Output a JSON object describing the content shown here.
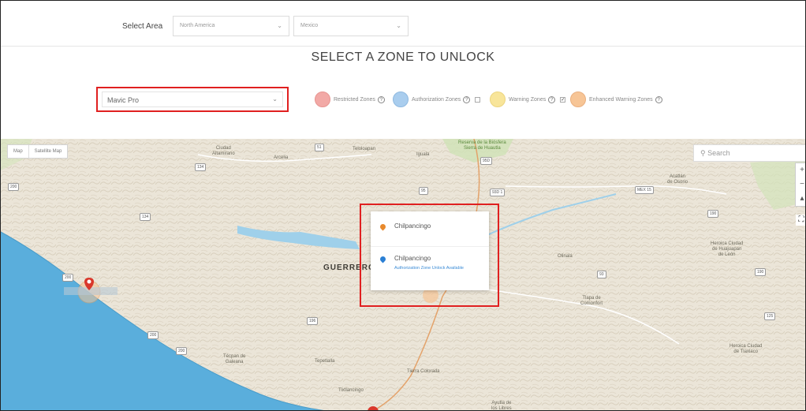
{
  "area_bar": {
    "label": "Select Area",
    "continent": "North America",
    "country": "Mexico"
  },
  "title": "SELECT A ZONE TO UNLOCK",
  "drone": {
    "selected": "Mavic Pro"
  },
  "legend": [
    {
      "label": "Restricted Zones",
      "color": "#f2a9a6"
    },
    {
      "label": "Authorization Zones",
      "color": "#a9cdee"
    },
    {
      "label": "Warning Zones",
      "color": "#f8e59a"
    },
    {
      "label": "Enhanced Warning Zones",
      "color": "#f7c596"
    }
  ],
  "map": {
    "map_button": "Map",
    "satellite_button": "Satellite Map",
    "search_placeholder": "Search",
    "zoom_in": "+",
    "zoom_out": "−",
    "labels": {
      "ciudad_altamirano": "Ciudad\nAltamirano",
      "arcelia": "Arcelia",
      "teloloapan": "Teloloapan",
      "iguala": "Iguala",
      "reserva": "Reserva de la Biósfera\nSierra de Huautla",
      "acatlan": "Acatlán\nde Osorio",
      "guerrero": "GUERRERO",
      "olinala": "Olinalá",
      "huajuapan": "Heroica Ciudad\nde Huajuapan\nde León",
      "tlapa": "Tlapa de\nComonfort",
      "tlaxiaco": "Heroica Ciudad\nde Tlaxiaco",
      "tecpan": "Técpan de\nGaleana",
      "tepetlalla": "Tepetlalla",
      "tierra_colorada": "Tierra Colorada",
      "tixtlancingo": "Tixtlancingo",
      "ayutla": "Ayutla de\nlos Libres"
    }
  },
  "popup": {
    "item1_name": "Chilpancingo",
    "item2_name": "Chilpancingo",
    "item2_link": "Authorization Zone Unlock Available"
  },
  "colors": {
    "highlight": "#e02020",
    "ocean": "#5aaedc",
    "pin_red": "#d9372b",
    "pin_orange": "#e8892c",
    "pin_blue": "#2a7fd4"
  }
}
